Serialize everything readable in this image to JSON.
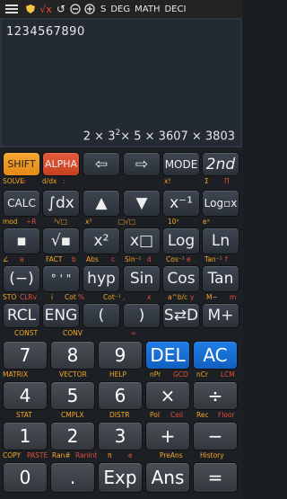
{
  "status": {
    "mode_s": "S",
    "mode_deg": "DEG",
    "mode_math": "MATH",
    "mode_deci": "DECI"
  },
  "display": {
    "expression": "1234567890",
    "result_parts": [
      "2 × 3",
      "2",
      "× 5 × 3607 × 3803"
    ]
  },
  "rows": [
    {
      "keys": [
        "SHIFT",
        "ALPHA",
        "⇦",
        "⇨",
        "MODE",
        "2nd"
      ],
      "labels": [
        {
          "t": "SOLVE",
          "c": "o"
        },
        {
          "t": "=",
          "c": "r"
        },
        {
          "t": "d/dx",
          "c": "o"
        },
        {
          "t": ":",
          "c": "r"
        },
        {
          "t": "x!",
          "c": "o"
        },
        {
          "t": "Σ",
          "c": "o"
        },
        {
          "t": "Π",
          "c": "r"
        }
      ]
    },
    {
      "keys": [
        "CALC",
        "∫dx",
        "▲",
        "▼",
        "x⁻¹",
        "Log▫x"
      ],
      "labels": [
        {
          "t": "mod",
          "c": "o"
        },
        {
          "t": "÷R",
          "c": "r"
        },
        {
          "t": "³√□",
          "c": "o"
        },
        {
          "t": "x³",
          "c": "o"
        },
        {
          "t": "□√□",
          "c": "o"
        },
        {
          "t": "10ˣ",
          "c": "o"
        },
        {
          "t": "eˣ",
          "c": "o"
        }
      ]
    },
    {
      "keys": [
        "▪",
        "√▪",
        "x²",
        "x□",
        "Log",
        "Ln"
      ],
      "labels": [
        {
          "t": "∠",
          "c": "o"
        },
        {
          "t": "a",
          "c": "r"
        },
        {
          "t": "FACT",
          "c": "o"
        },
        {
          "t": "b",
          "c": "r"
        },
        {
          "t": "Abs",
          "c": "o"
        },
        {
          "t": "c",
          "c": "r"
        },
        {
          "t": "Sin⁻¹",
          "c": "o"
        },
        {
          "t": "d",
          "c": "r"
        },
        {
          "t": "Cos⁻¹",
          "c": "o"
        },
        {
          "t": "e",
          "c": "r"
        },
        {
          "t": "Tan⁻¹",
          "c": "o"
        },
        {
          "t": "f",
          "c": "r"
        }
      ]
    },
    {
      "keys": [
        "(−)",
        "° ' \"",
        "hyp",
        "Sin",
        "Cos",
        "Tan"
      ],
      "labels": [
        {
          "t": "STO",
          "c": "o"
        },
        {
          "t": "CLRv",
          "c": "r"
        },
        {
          "t": "i",
          "c": "o"
        },
        {
          "t": "Cot",
          "c": "o"
        },
        {
          "t": "%",
          "c": "r"
        },
        {
          "t": "Cot⁻¹",
          "c": "o"
        },
        {
          "t": ",",
          "c": "r"
        },
        {
          "t": "x",
          "c": "r"
        },
        {
          "t": "a^b/c",
          "c": "o"
        },
        {
          "t": "y",
          "c": "r"
        },
        {
          "t": "M−",
          "c": "o"
        },
        {
          "t": "m",
          "c": "r"
        }
      ]
    },
    {
      "keys": [
        "RCL",
        "ENG",
        "(",
        ")",
        "S⇄D",
        "M+"
      ],
      "labels": [
        {
          "t": "CONST",
          "c": "o"
        },
        {
          "t": "CONV",
          "c": "o"
        },
        {
          "t": "∞",
          "c": "r"
        }
      ]
    },
    {
      "keys": [
        "7",
        "8",
        "9",
        "DEL",
        "AC"
      ],
      "labels": [
        {
          "t": "MATRIX",
          "c": "o"
        },
        {
          "t": "VECTOR",
          "c": "o"
        },
        {
          "t": "HELP",
          "c": "o"
        },
        {
          "t": "nPr",
          "c": "o"
        },
        {
          "t": "GCD",
          "c": "r"
        },
        {
          "t": "nCr",
          "c": "o"
        },
        {
          "t": "LCM",
          "c": "r"
        }
      ]
    },
    {
      "keys": [
        "4",
        "5",
        "6",
        "×",
        "÷"
      ],
      "labels": [
        {
          "t": "STAT",
          "c": "o"
        },
        {
          "t": "CMPLX",
          "c": "o"
        },
        {
          "t": "DISTR",
          "c": "o"
        },
        {
          "t": "Pol",
          "c": "o"
        },
        {
          "t": "Ceil",
          "c": "r"
        },
        {
          "t": "Rec",
          "c": "o"
        },
        {
          "t": "Floor",
          "c": "r"
        }
      ]
    },
    {
      "keys": [
        "1",
        "2",
        "3",
        "+",
        "−"
      ],
      "labels": [
        {
          "t": "COPY",
          "c": "o"
        },
        {
          "t": "PASTE",
          "c": "r"
        },
        {
          "t": "Ran#",
          "c": "o"
        },
        {
          "t": "RanInt",
          "c": "r"
        },
        {
          "t": "π",
          "c": "o"
        },
        {
          "t": "e",
          "c": "r"
        },
        {
          "t": "PreAns",
          "c": "o"
        },
        {
          "t": "History",
          "c": "o"
        }
      ]
    },
    {
      "keys": [
        "0",
        ".",
        "Exp",
        "Ans",
        "="
      ],
      "labels": []
    }
  ]
}
